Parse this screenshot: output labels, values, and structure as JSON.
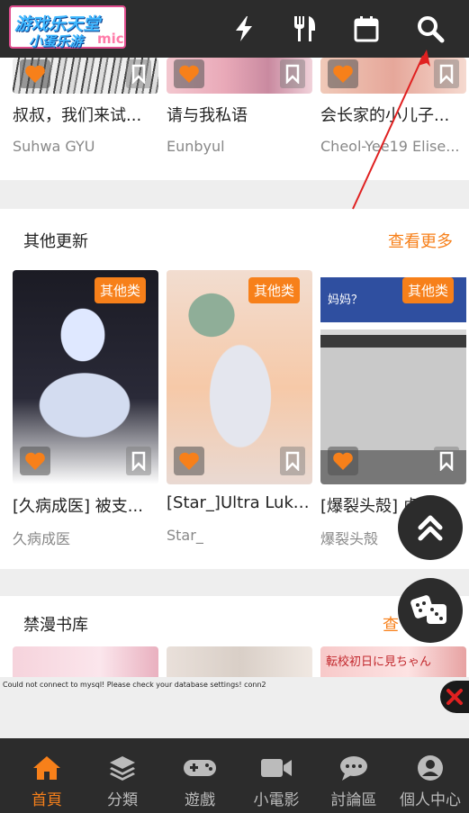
{
  "header": {
    "logo": {
      "line1": "游戏乐天堂",
      "line2": "小蛋乐游",
      "suffix": "mic"
    },
    "icons": [
      "bolt-icon",
      "utensils-icon",
      "calendar-icon",
      "search-icon"
    ]
  },
  "top_cards": [
    {
      "title": "叔叔，我们来试...",
      "author": "Suhwa GYU"
    },
    {
      "title": "请与我私语",
      "author": "Eunbyul"
    },
    {
      "title": "会长家的小儿子...",
      "author": "Cheol-Yee19 Elise..."
    }
  ],
  "other_updates": {
    "title": "其他更新",
    "more": "查看更多",
    "cards": [
      {
        "badge": "其他类",
        "title": "[久病成医] 被支...",
        "author": "久病成医"
      },
      {
        "badge": "其他类",
        "title": "[Star_]Ultra Luka...",
        "author": "Star_"
      },
      {
        "badge": "其他类",
        "title": "[爆裂头殻] 虎...",
        "author": "爆裂头殻",
        "thumb_text": "妈妈？"
      }
    ]
  },
  "library": {
    "title": "禁漫书库",
    "more": "查",
    "banner_text": "転校初日に見ちゃん"
  },
  "ad": {
    "text": "Could not connect to mysql! Please check your database settings! conn2"
  },
  "bottom_nav": [
    {
      "label": "首頁",
      "icon": "home-icon",
      "active": true
    },
    {
      "label": "分類",
      "icon": "layers-icon",
      "active": false
    },
    {
      "label": "遊戲",
      "icon": "gamepad-icon",
      "active": false
    },
    {
      "label": "小電影",
      "icon": "video-icon",
      "active": false
    },
    {
      "label": "討論區",
      "icon": "chat-icon",
      "active": false
    },
    {
      "label": "個人中心",
      "icon": "user-icon",
      "active": false
    }
  ],
  "colors": {
    "accent": "#f7801a",
    "bar": "#2c2c2c",
    "annotation": "#e02020"
  }
}
